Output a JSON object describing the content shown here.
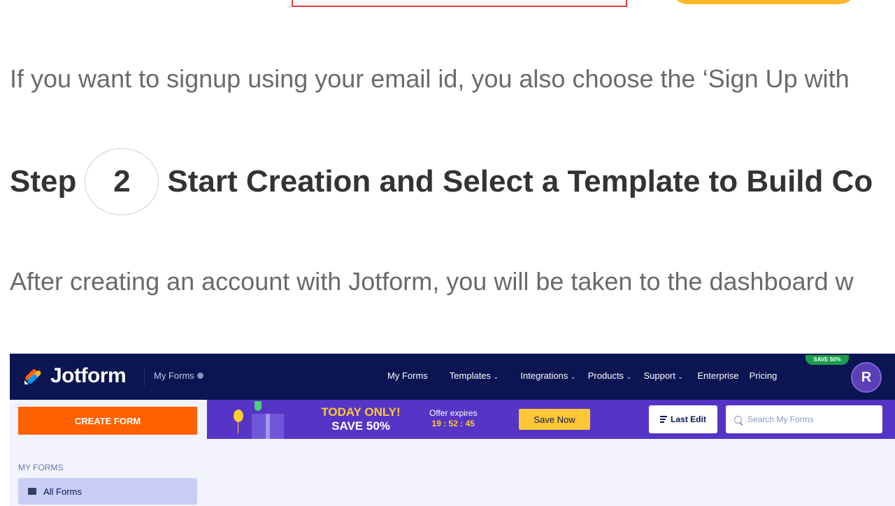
{
  "article": {
    "para_signup": "If you want to signup using your email id, you also choose the ‘Sign Up with",
    "step_word": "Step",
    "step_number": "2",
    "step_title": "Start Creation and Select a Template to Build Co",
    "para_dashboard": "After creating an account with Jotform, you will be taken to the dashboard w"
  },
  "jotform": {
    "logo_text": "Jotform",
    "breadcrumb": "My Forms",
    "nav": [
      {
        "label": "My Forms",
        "chevron": ""
      },
      {
        "label": "Templates",
        "chevron": "⌄"
      },
      {
        "label": "Integrations",
        "chevron": "⌄"
      },
      {
        "label": "Products",
        "chevron": "⌄"
      },
      {
        "label": "Support",
        "chevron": "⌄"
      },
      {
        "label": "Enterprise",
        "chevron": ""
      },
      {
        "label": "Pricing",
        "chevron": ""
      }
    ],
    "save_badge": "SAVE 50%",
    "avatar_initial": "R",
    "create_form": "CREATE FORM",
    "sidebar_heading": "MY FORMS",
    "sidebar_item": "All Forms",
    "banner": {
      "today_line1": "TODAY ONLY!",
      "today_line2": "SAVE 50%",
      "offer_line1": "Offer expires",
      "offer_timer": "19 : 52 : 45",
      "save_now": "Save Now"
    },
    "sort_label": "Last Edit",
    "search_placeholder": "Search My Forms"
  },
  "colors": {
    "navbar": "#0a1551",
    "create_button": "#ff6100",
    "banner": "#5534c6",
    "accent_yellow": "#ffc635",
    "avatar": "#5b3fb8"
  },
  "icons": [
    "jotform-logo-icon",
    "folder-icon",
    "search-icon",
    "sort-icon",
    "balloon-icon",
    "gift-icon"
  ]
}
